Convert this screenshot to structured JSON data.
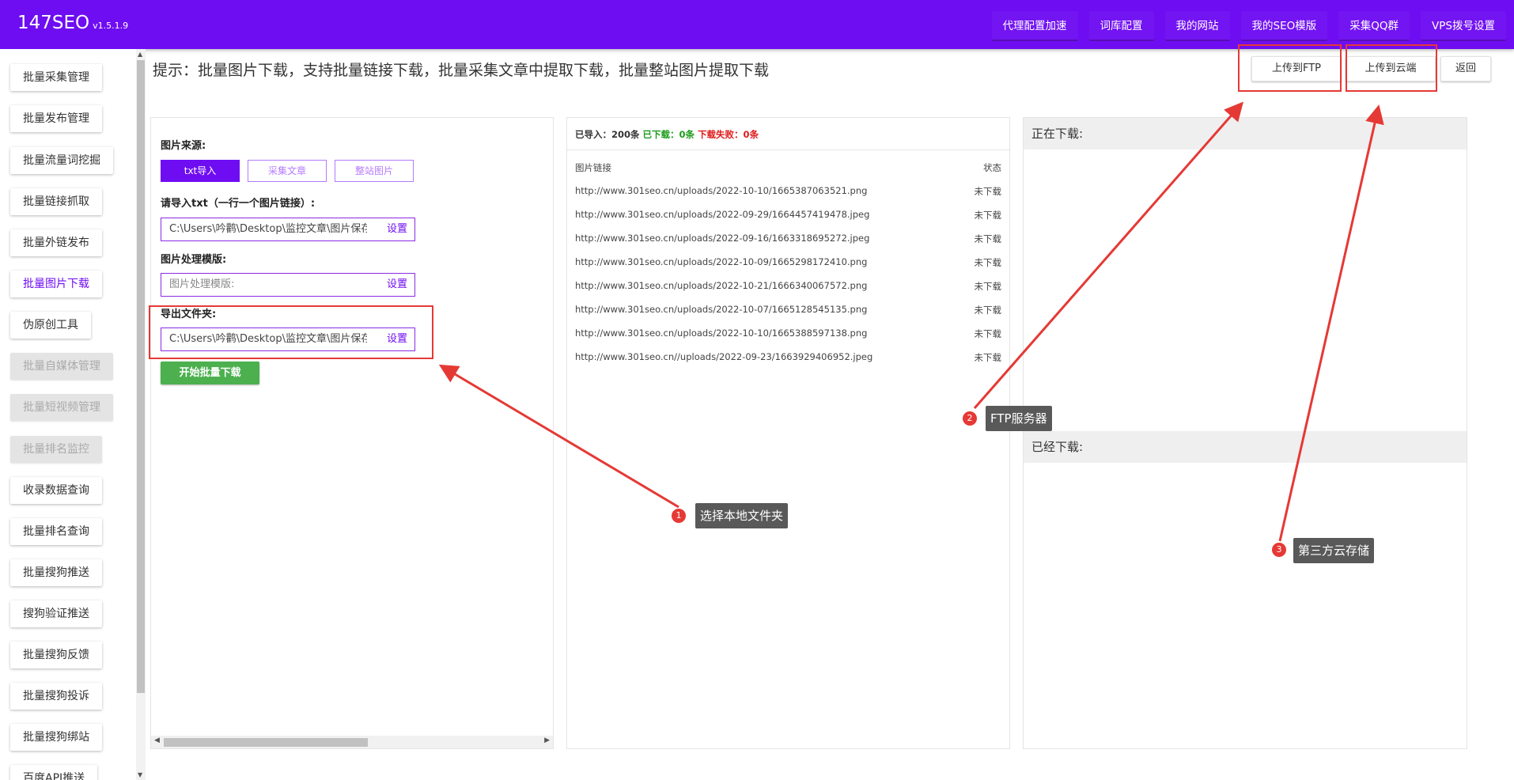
{
  "app": {
    "title": "147SEO",
    "version": "v1.5.1.9"
  },
  "topnav": [
    "代理配置加速",
    "词库配置",
    "我的网站",
    "我的SEO模版",
    "采集QQ群",
    "VPS拨号设置"
  ],
  "sidebar": [
    {
      "label": "批量采集管理",
      "state": "normal"
    },
    {
      "label": "批量发布管理",
      "state": "normal"
    },
    {
      "label": "批量流量词挖掘",
      "state": "normal"
    },
    {
      "label": "批量链接抓取",
      "state": "normal"
    },
    {
      "label": "批量外链发布",
      "state": "normal"
    },
    {
      "label": "批量图片下载",
      "state": "active"
    },
    {
      "label": "伪原创工具",
      "state": "normal"
    },
    {
      "label": "批量自媒体管理",
      "state": "disabled"
    },
    {
      "label": "批量短视频管理",
      "state": "disabled"
    },
    {
      "label": "批量排名监控",
      "state": "disabled"
    },
    {
      "label": "收录数据查询",
      "state": "normal"
    },
    {
      "label": "批量排名查询",
      "state": "normal"
    },
    {
      "label": "批量搜狗推送",
      "state": "normal"
    },
    {
      "label": "搜狗验证推送",
      "state": "normal"
    },
    {
      "label": "批量搜狗反馈",
      "state": "normal"
    },
    {
      "label": "批量搜狗投诉",
      "state": "normal"
    },
    {
      "label": "批量搜狗绑站",
      "state": "normal"
    },
    {
      "label": "百度API推送",
      "state": "normal"
    }
  ],
  "hint": "提示：批量图片下载，支持批量链接下载，批量采集文章中提取下载，批量整站图片提取下载",
  "actions": {
    "upload_ftp": "上传到FTP",
    "upload_cloud": "上传到云端",
    "back": "返回"
  },
  "form": {
    "source_label": "图片来源:",
    "sources": [
      "txt导入",
      "采集文章",
      "整站图片"
    ],
    "active_source": 0,
    "txt_label": "请导入txt（一行一个图片链接）:",
    "txt_value": "C:\\Users\\吟鹳\\Desktop\\监控文章\\图片保存",
    "template_label": "图片处理模版:",
    "template_placeholder": "图片处理模版:",
    "export_label": "导出文件夹:",
    "export_value": "C:\\Users\\吟鹳\\Desktop\\监控文章\\图片保存",
    "set_label": "设置",
    "start_button": "开始批量下载"
  },
  "stats": {
    "imported_label": "已导入：200条",
    "downloaded_label": "已下载：0条",
    "failed_label": "下载失败：0条"
  },
  "list": {
    "col_link": "图片链接",
    "col_status": "状态",
    "rows": [
      {
        "url": "http://www.301seo.cn/uploads/2022-10-10/1665387063521.png",
        "status": "未下载"
      },
      {
        "url": "http://www.301seo.cn/uploads/2022-09-29/1664457419478.jpeg",
        "status": "未下载"
      },
      {
        "url": "http://www.301seo.cn/uploads/2022-09-16/1663318695272.jpeg",
        "status": "未下载"
      },
      {
        "url": "http://www.301seo.cn/uploads/2022-10-09/1665298172410.png",
        "status": "未下载"
      },
      {
        "url": "http://www.301seo.cn/uploads/2022-10-21/1666340067572.png",
        "status": "未下载"
      },
      {
        "url": "http://www.301seo.cn/uploads/2022-10-07/1665128545135.png",
        "status": "未下载"
      },
      {
        "url": "http://www.301seo.cn/uploads/2022-10-10/1665388597138.png",
        "status": "未下载"
      },
      {
        "url": "http://www.301seo.cn//uploads/2022-09-23/1663929406952.jpeg",
        "status": "未下载"
      }
    ]
  },
  "downloading_title": "正在下载:",
  "downloaded_title": "已经下载:",
  "annotations": [
    {
      "num": "1",
      "text": "选择本地文件夹"
    },
    {
      "num": "2",
      "text": "FTP服务器"
    },
    {
      "num": "3",
      "text": "第三方云存储"
    }
  ],
  "colors": {
    "brand": "#6f0df2",
    "start": "#4cb04f",
    "annotation": "#e53935",
    "ok": "#1a9c1a",
    "fail": "#e01b1b"
  }
}
